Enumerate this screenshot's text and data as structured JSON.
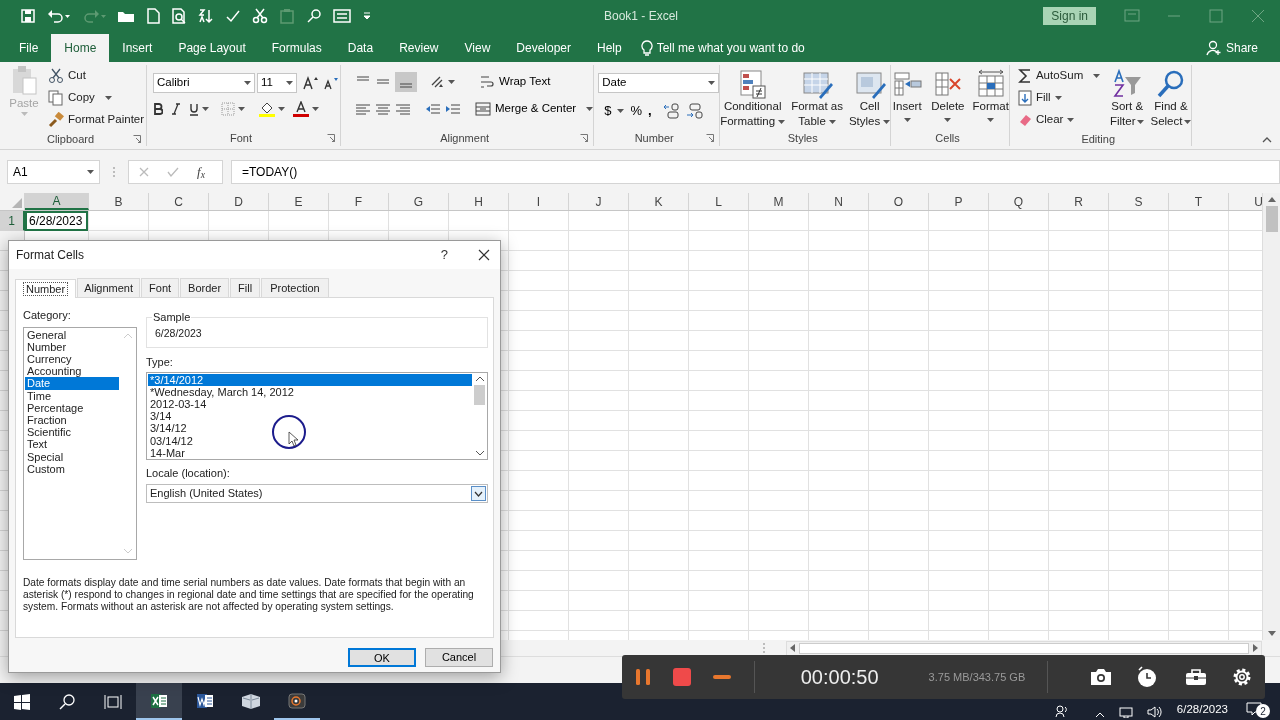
{
  "window": {
    "title": "Book1 - Excel",
    "sign_in": "Sign in"
  },
  "quick_access": [
    {
      "kind": "save",
      "disabled": false
    },
    {
      "kind": "undo",
      "disabled": false
    },
    {
      "kind": "redo",
      "disabled": true
    },
    {
      "kind": "open",
      "disabled": false
    },
    {
      "kind": "new",
      "disabled": false
    },
    {
      "kind": "preview",
      "disabled": false
    },
    {
      "kind": "sort",
      "disabled": false
    },
    {
      "kind": "spelling",
      "disabled": false
    },
    {
      "kind": "cut",
      "disabled": false
    },
    {
      "kind": "paste",
      "disabled": true
    },
    {
      "kind": "find",
      "disabled": false
    },
    {
      "kind": "form",
      "disabled": false
    },
    {
      "kind": "customize",
      "disabled": false
    }
  ],
  "ribbon_tabs": [
    {
      "label": "File",
      "selected": false
    },
    {
      "label": "Home",
      "selected": true
    },
    {
      "label": "Insert",
      "selected": false
    },
    {
      "label": "Page Layout",
      "selected": false
    },
    {
      "label": "Formulas",
      "selected": false
    },
    {
      "label": "Data",
      "selected": false
    },
    {
      "label": "Review",
      "selected": false
    },
    {
      "label": "View",
      "selected": false
    },
    {
      "label": "Developer",
      "selected": false
    },
    {
      "label": "Help",
      "selected": false
    }
  ],
  "tell_me": "Tell me what you want to do",
  "share": "Share",
  "clipboard": {
    "paste": {
      "label": "Paste",
      "disabled": true
    },
    "cut": "Cut",
    "copy": "Copy",
    "format_painter": "Format Painter",
    "label": "Clipboard"
  },
  "font": {
    "name": "Calibri",
    "size": "11",
    "label": "Font"
  },
  "alignment": {
    "wrap_text": "Wrap Text",
    "merge": "Merge & Center",
    "label": "Alignment"
  },
  "number": {
    "format": "Date",
    "currency": "$",
    "percent": "%",
    "comma": ",",
    "label": "Number"
  },
  "styles": {
    "buttons": [
      {
        "kind": "conditional",
        "lines": [
          "Conditional",
          "Formatting"
        ]
      },
      {
        "kind": "table",
        "lines": [
          "Format as",
          "Table"
        ]
      },
      {
        "kind": "cellstyles",
        "lines": [
          "Cell",
          "Styles"
        ]
      }
    ],
    "label": "Styles"
  },
  "cells": {
    "buttons": [
      {
        "kind": "insert",
        "label": "Insert"
      },
      {
        "kind": "delete",
        "label": "Delete"
      },
      {
        "kind": "format",
        "label": "Format"
      }
    ],
    "label": "Cells"
  },
  "editing": {
    "autosum": "AutoSum",
    "fill": "Fill",
    "clear": "Clear",
    "sort": [
      "Sort &",
      "Filter"
    ],
    "find": [
      "Find &",
      "Select"
    ],
    "label": "Editing"
  },
  "formula_bar": {
    "name_box": "A1",
    "insert_function": "f$_{x}$",
    "formula": "=TODAY()"
  },
  "sheet": {
    "columns": [
      {
        "label": "A",
        "selected": true
      },
      {
        "label": "B",
        "selected": false
      },
      {
        "label": "C",
        "selected": false
      },
      {
        "label": "D",
        "selected": false
      },
      {
        "label": "E",
        "selected": false
      },
      {
        "label": "F",
        "selected": false
      },
      {
        "label": "G",
        "selected": false
      },
      {
        "label": "H",
        "selected": false
      },
      {
        "label": "I",
        "selected": false
      },
      {
        "label": "J",
        "selected": false
      },
      {
        "label": "K",
        "selected": false
      },
      {
        "label": "L",
        "selected": false
      },
      {
        "label": "M",
        "selected": false
      },
      {
        "label": "N",
        "selected": false
      },
      {
        "label": "O",
        "selected": false
      },
      {
        "label": "P",
        "selected": false
      },
      {
        "label": "Q",
        "selected": false
      },
      {
        "label": "R",
        "selected": false
      },
      {
        "label": "S",
        "selected": false
      },
      {
        "label": "T",
        "selected": false
      },
      {
        "label": "U",
        "selected": false
      }
    ],
    "row_headers": [
      {
        "label": "1",
        "selected": true
      }
    ],
    "cell_a1": "6/28/2023"
  },
  "dialog": {
    "title": "Format Cells",
    "help": "?",
    "tabs": [
      {
        "label": "Number",
        "selected": true
      },
      {
        "label": "Alignment",
        "selected": false
      },
      {
        "label": "Font",
        "selected": false
      },
      {
        "label": "Border",
        "selected": false
      },
      {
        "label": "Fill",
        "selected": false
      },
      {
        "label": "Protection",
        "selected": false
      }
    ],
    "category_label": "Category:",
    "categories": [
      {
        "label": "General",
        "selected": false
      },
      {
        "label": "Number",
        "selected": false
      },
      {
        "label": "Currency",
        "selected": false
      },
      {
        "label": "Accounting",
        "selected": false
      },
      {
        "label": "Date",
        "selected": true
      },
      {
        "label": "Time",
        "selected": false
      },
      {
        "label": "Percentage",
        "selected": false
      },
      {
        "label": "Fraction",
        "selected": false
      },
      {
        "label": "Scientific",
        "selected": false
      },
      {
        "label": "Text",
        "selected": false
      },
      {
        "label": "Special",
        "selected": false
      },
      {
        "label": "Custom",
        "selected": false
      }
    ],
    "sample_label": "Sample",
    "sample": "6/28/2023",
    "type_label": "Type:",
    "types": [
      {
        "label": "*3/14/2012",
        "selected": true
      },
      {
        "label": "*Wednesday, March 14, 2012",
        "selected": false
      },
      {
        "label": "2012-03-14",
        "selected": false
      },
      {
        "label": "3/14",
        "selected": false
      },
      {
        "label": "3/14/12",
        "selected": false
      },
      {
        "label": "03/14/12",
        "selected": false
      },
      {
        "label": "14-Mar",
        "selected": false
      }
    ],
    "locale_label": "Locale (location):",
    "locale": "English (United States)",
    "description": "Date formats display date and time serial numbers as date values. Date formats that begin with an asterisk (*) respond to changes in regional date and time settings that are specified for the operating system. Formats without an asterisk are not affected by operating system settings.",
    "buttons": [
      {
        "label": "OK",
        "default": true
      },
      {
        "label": "Cancel",
        "default": false
      }
    ]
  },
  "recorder": {
    "time": "00:00:50",
    "size": "3.75 MB/343.75 GB"
  },
  "taskbar": {
    "apps": [
      {
        "kind": "excel",
        "selected": true,
        "open": true
      },
      {
        "kind": "word",
        "selected": false,
        "open": false
      },
      {
        "kind": "book",
        "selected": false,
        "open": false
      },
      {
        "kind": "recorder",
        "selected": false,
        "open": true
      }
    ],
    "date": "6/28/2023",
    "notifications": "2"
  }
}
